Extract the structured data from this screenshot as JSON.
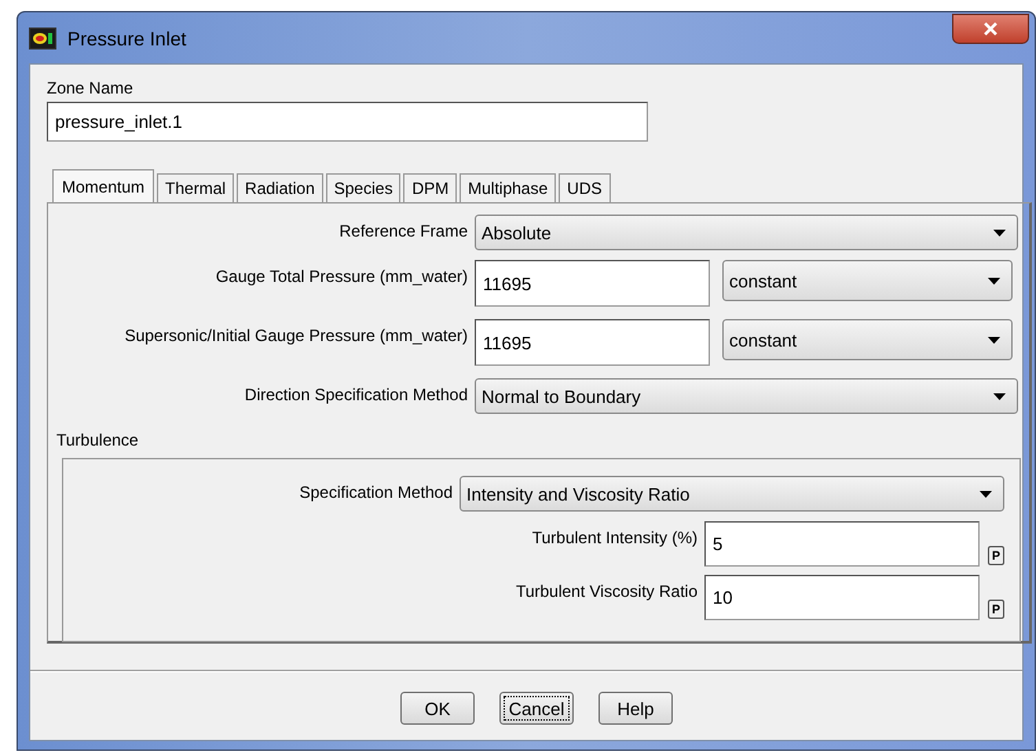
{
  "window": {
    "title": "Pressure Inlet"
  },
  "zone_name": {
    "label": "Zone Name",
    "value": "pressure_inlet.1"
  },
  "tabs": [
    {
      "label": "Momentum",
      "selected": true
    },
    {
      "label": "Thermal",
      "selected": false
    },
    {
      "label": "Radiation",
      "selected": false
    },
    {
      "label": "Species",
      "selected": false
    },
    {
      "label": "DPM",
      "selected": false
    },
    {
      "label": "Multiphase",
      "selected": false
    },
    {
      "label": "UDS",
      "selected": false
    }
  ],
  "fields": [
    {
      "kind": "dropdown",
      "label": "Reference Frame",
      "value": "Absolute"
    },
    {
      "kind": "input_dropdown",
      "label": "Gauge Total Pressure (mm_water)",
      "value": "11695",
      "option": "constant"
    },
    {
      "kind": "input_dropdown",
      "label": "Supersonic/Initial Gauge Pressure (mm_water)",
      "value": "11695",
      "option": "constant"
    },
    {
      "kind": "dropdown",
      "label": "Direction Specification Method",
      "value": "Normal to Boundary"
    }
  ],
  "turbulence": {
    "title": "Turbulence",
    "fields": [
      {
        "kind": "dropdown",
        "label": "Specification Method",
        "value": "Intensity and Viscosity Ratio"
      },
      {
        "kind": "input_param",
        "label": "Turbulent Intensity (%)",
        "value": "5",
        "param": "P"
      },
      {
        "kind": "input_param",
        "label": "Turbulent Viscosity Ratio",
        "value": "10",
        "param": "P"
      }
    ]
  },
  "buttons": [
    {
      "label": "OK",
      "focused": false
    },
    {
      "label": "Cancel",
      "focused": true
    },
    {
      "label": "Help",
      "focused": false
    }
  ]
}
